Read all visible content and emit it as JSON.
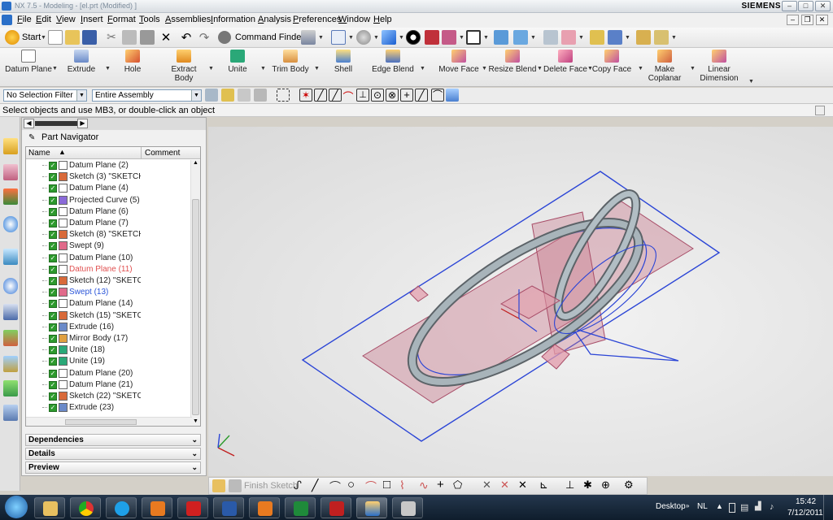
{
  "title": {
    "text": "NX 7.5 - Modeling - [el.prt (Modified) ]",
    "brand": "SIEMENS"
  },
  "menu": [
    "File",
    "Edit",
    "View",
    "Insert",
    "Format",
    "Tools",
    "Assemblies",
    "Information",
    "Analysis",
    "Preferences",
    "Window",
    "Help"
  ],
  "standard": {
    "start": "Start",
    "command_finder": "Command Finder"
  },
  "feature_toolbar": [
    {
      "label": "Datum Plane",
      "icon": "datum-plane-icon"
    },
    {
      "label": "Extrude",
      "icon": "extrude-icon"
    },
    {
      "label": "Hole",
      "icon": "hole-icon"
    },
    {
      "label": "Extract Body",
      "icon": "extract-body-icon"
    },
    {
      "label": "Unite",
      "icon": "unite-icon"
    },
    {
      "label": "Trim Body",
      "icon": "trim-body-icon"
    },
    {
      "label": "Shell",
      "icon": "shell-icon"
    },
    {
      "label": "Edge Blend",
      "icon": "edge-blend-icon"
    },
    {
      "label": "Move Face",
      "icon": "move-face-icon"
    },
    {
      "label": "Resize Blend",
      "icon": "resize-blend-icon"
    },
    {
      "label": "Delete Face",
      "icon": "delete-face-icon"
    },
    {
      "label": "Copy Face",
      "icon": "copy-face-icon"
    },
    {
      "label": "Make Coplanar",
      "icon": "make-coplanar-icon"
    },
    {
      "label": "Linear Dimension",
      "icon": "linear-dimension-icon"
    }
  ],
  "selection": {
    "filter": "No Selection Filter",
    "scope": "Entire Assembly"
  },
  "cue_line": "Select objects and use MB3, or double-click an object",
  "navigator": {
    "title": "Part Navigator",
    "columns": {
      "name": "Name",
      "comment": "Comment"
    },
    "items": [
      {
        "label": "Datum Plane (2)",
        "icon": "datum-plane-icon",
        "state": "normal"
      },
      {
        "label": "Sketch (3) \"SKETCH...",
        "icon": "sketch-icon",
        "state": "normal"
      },
      {
        "label": "Datum Plane (4)",
        "icon": "datum-plane-icon",
        "state": "normal"
      },
      {
        "label": "Projected Curve (5)",
        "icon": "projected-curve-icon",
        "state": "normal"
      },
      {
        "label": "Datum Plane (6)",
        "icon": "datum-plane-icon",
        "state": "normal"
      },
      {
        "label": "Datum Plane (7)",
        "icon": "datum-plane-icon",
        "state": "normal"
      },
      {
        "label": "Sketch (8) \"SKETCH...",
        "icon": "sketch-icon",
        "state": "normal"
      },
      {
        "label": "Swept (9)",
        "icon": "swept-icon",
        "state": "normal"
      },
      {
        "label": "Datum Plane (10)",
        "icon": "datum-plane-icon",
        "state": "normal"
      },
      {
        "label": "Datum Plane (11)",
        "icon": "datum-plane-icon",
        "state": "error"
      },
      {
        "label": "Sketch (12) \"SKETC...",
        "icon": "sketch-icon",
        "state": "normal"
      },
      {
        "label": "Swept (13)",
        "icon": "swept-icon",
        "state": "current"
      },
      {
        "label": "Datum Plane (14)",
        "icon": "datum-plane-icon",
        "state": "normal"
      },
      {
        "label": "Sketch (15) \"SKETC...",
        "icon": "sketch-icon",
        "state": "normal"
      },
      {
        "label": "Extrude (16)",
        "icon": "extrude-icon",
        "state": "normal"
      },
      {
        "label": "Mirror Body (17)",
        "icon": "mirror-body-icon",
        "state": "normal"
      },
      {
        "label": "Unite (18)",
        "icon": "unite-icon",
        "state": "normal"
      },
      {
        "label": "Unite (19)",
        "icon": "unite-icon",
        "state": "normal"
      },
      {
        "label": "Datum Plane (20)",
        "icon": "datum-plane-icon",
        "state": "normal"
      },
      {
        "label": "Datum Plane (21)",
        "icon": "datum-plane-icon",
        "state": "normal"
      },
      {
        "label": "Sketch (22) \"SKETC...",
        "icon": "sketch-icon",
        "state": "normal"
      },
      {
        "label": "Extrude (23)",
        "icon": "extrude-icon",
        "state": "normal"
      }
    ],
    "panels": [
      "Dependencies",
      "Details",
      "Preview"
    ]
  },
  "sketch_toolbar": {
    "finish": "Finish Sketch"
  },
  "taskbar": {
    "desktop": "Desktop",
    "lang": "NL",
    "time": "15:42",
    "date": "7/12/2011"
  },
  "colors": {
    "error": "#e05050",
    "current": "#2a55d8",
    "check": "#2d9a2d",
    "datum": "#c87a8c",
    "curve": "#2b45d6",
    "body": "#9aa6ac"
  }
}
